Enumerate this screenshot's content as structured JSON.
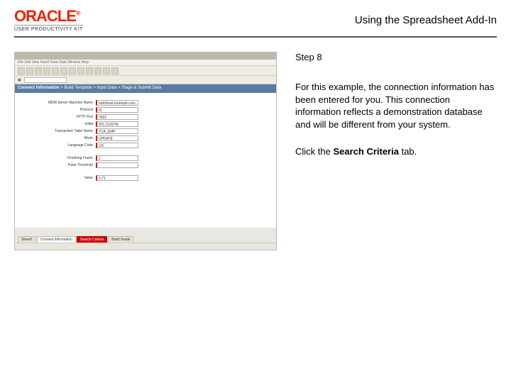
{
  "header": {
    "brand_main": "ORACLE",
    "brand_sub": "USER PRODUCTIVITY KIT",
    "title": "Using the Spreadsheet Add-In"
  },
  "step": {
    "label": "Step 8",
    "body": "For this example, the connection information has been entered for you. This connection information reflects a demonstration database and will be different from your system.",
    "action_prefix": "Click the ",
    "action_bold": "Search Criteria",
    "action_suffix": " tab."
  },
  "thumb": {
    "menubar": "File  Edit  View  Insert  Tools  Data  Window  Help",
    "breadcrumb_active": "Connect Information",
    "breadcrumb_rest": " > Build Template > Input Data > Stage & Submit Data",
    "form": [
      {
        "label": "MDM Server Machine Name",
        "value": "mdmhost.example.com"
      },
      {
        "label": "Protocol",
        "value": "t3"
      },
      {
        "label": "HTTP Port",
        "value": "7001"
      },
      {
        "label": "Initial",
        "value": "SH_CUSTM"
      },
      {
        "label": "Transaction Table Name",
        "value": "TCA_EMP"
      },
      {
        "label": "Mode",
        "value": "UPDATE"
      },
      {
        "label": "Language Code",
        "value": "US"
      },
      {
        "label": "",
        "value": ""
      },
      {
        "label": "Chunking Factor",
        "value": "1"
      },
      {
        "label": "Pane Threshold",
        "value": ""
      },
      {
        "label": "",
        "value": ""
      },
      {
        "label": "Value",
        "value": "0.71"
      }
    ],
    "tabs": {
      "sheet1": "Sheet1",
      "conn": "Connect Information",
      "search": "Search Criteria",
      "build": "Build Xwalk"
    }
  }
}
